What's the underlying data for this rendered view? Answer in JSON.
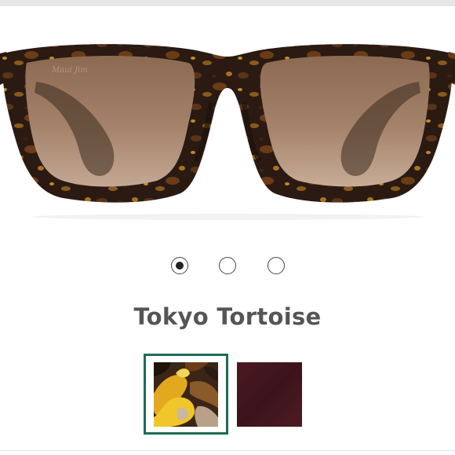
{
  "product": {
    "image_alt": "Tokyo Tortoise sunglasses front view",
    "brand_mark": "Maui Jim"
  },
  "carousel": {
    "slide_count": 3,
    "active_index": 0
  },
  "color": {
    "selected_name": "Tokyo Tortoise"
  },
  "swatches": [
    {
      "name": "tortoise",
      "selected": true
    },
    {
      "name": "burgundy",
      "selected": false
    }
  ],
  "colors": {
    "selected_border": "#1f6b57",
    "frame_dark": "#2b1a12",
    "lens_tint": "#9a785e",
    "burgundy": "#4a1b22"
  }
}
